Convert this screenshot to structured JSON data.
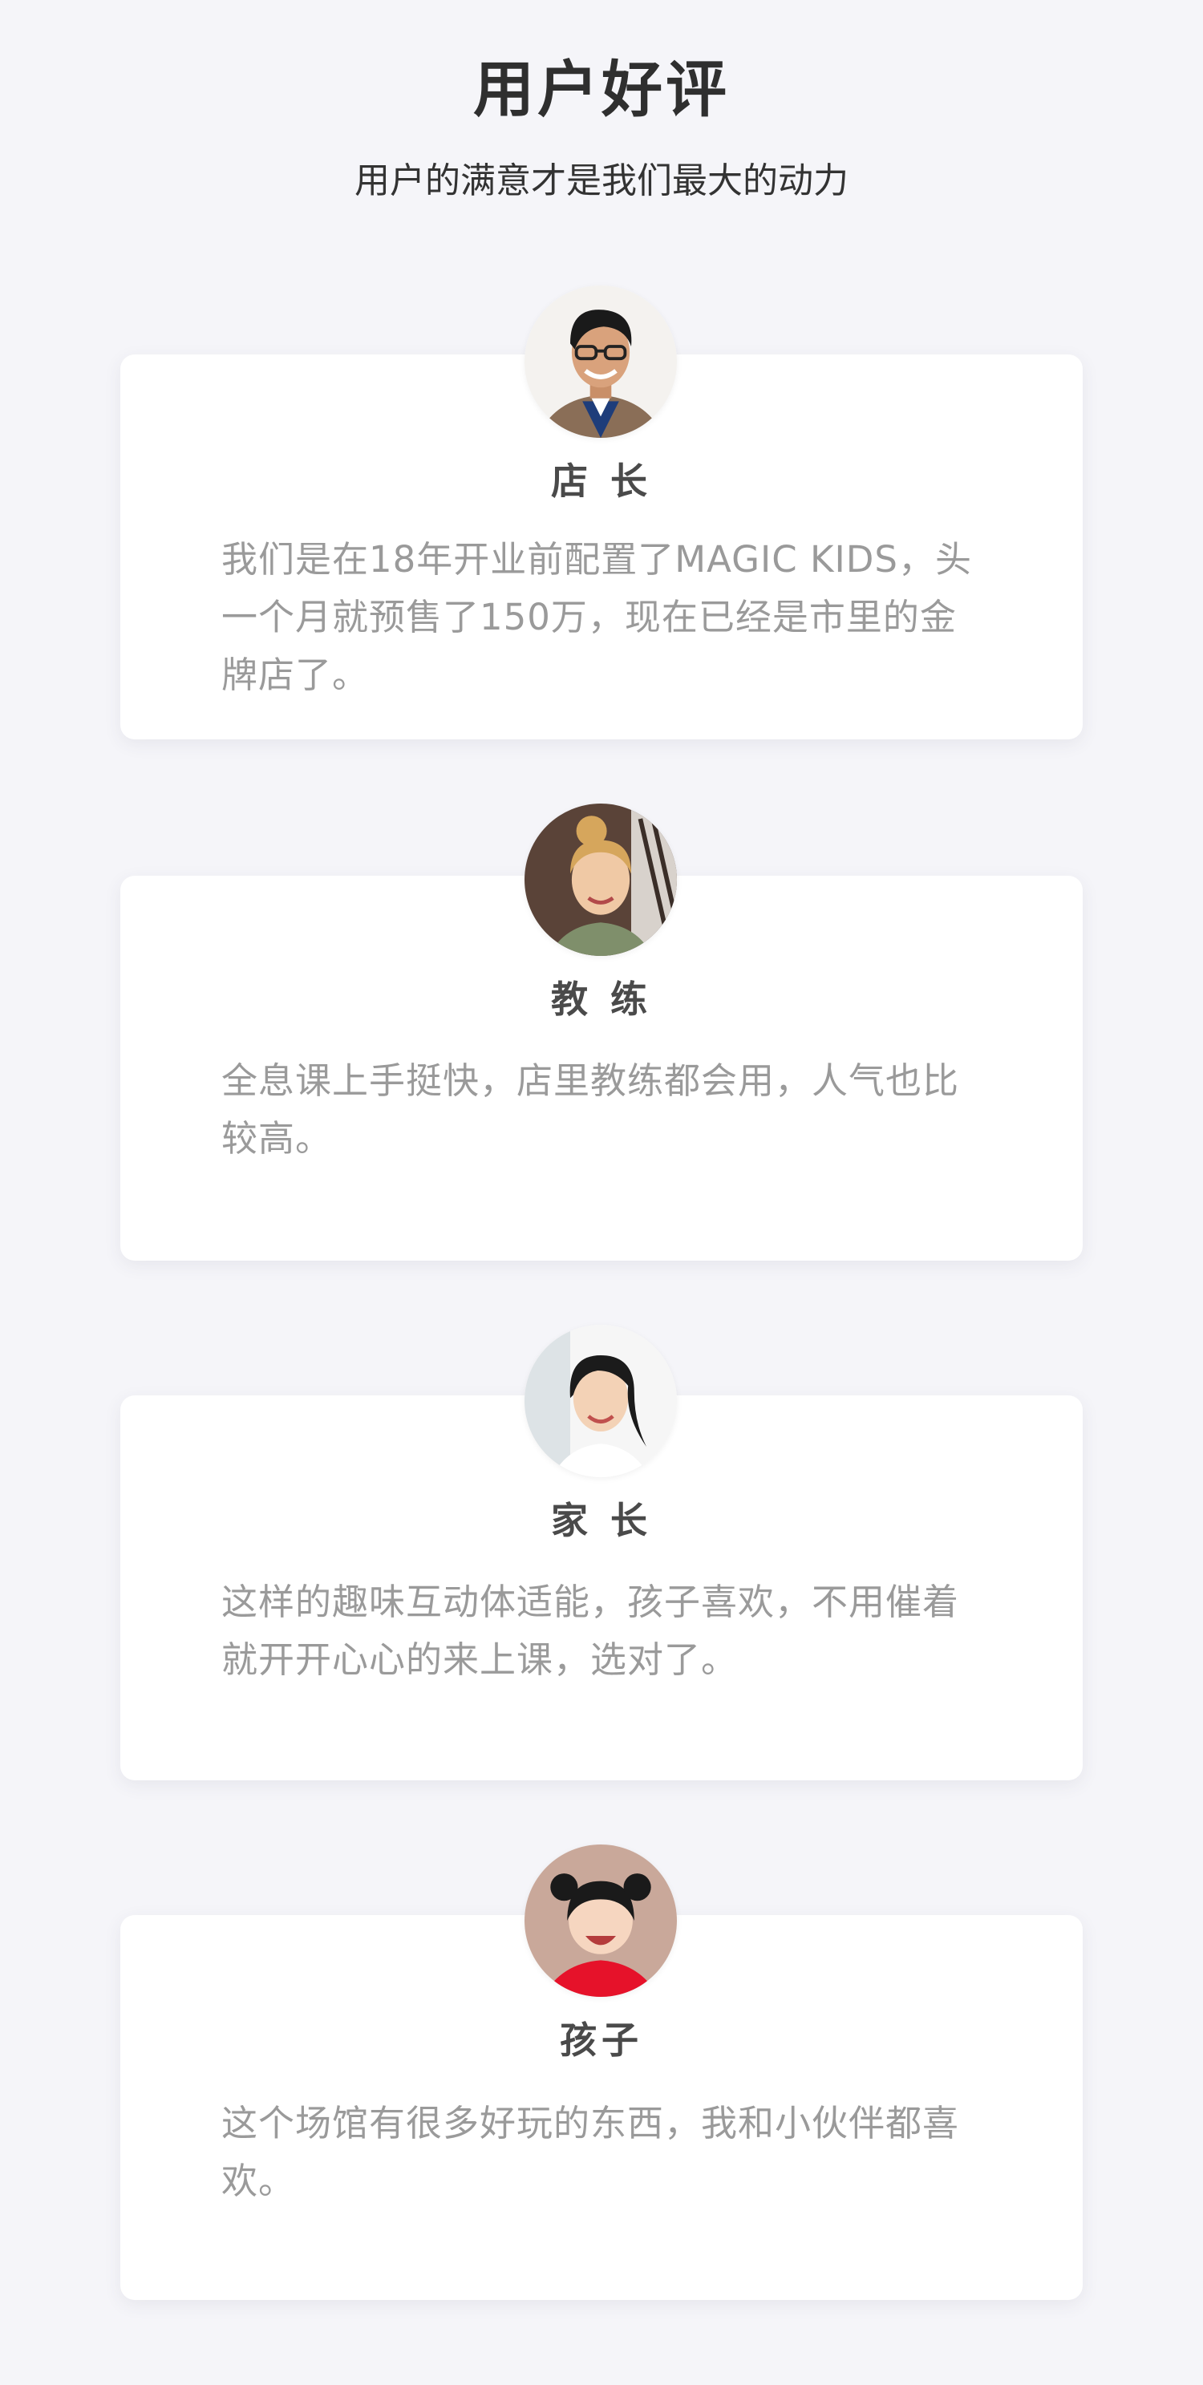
{
  "header": {
    "title": "用户好评",
    "subtitle": "用户的满意才是我们最大的动力"
  },
  "reviews": [
    {
      "role": "店 长",
      "text": "我们是在18年开业前配置了MAGIC KIDS，头一个月就预售了150万，现在已经是市里的金牌店了。",
      "avatar_icon": "store-manager-avatar"
    },
    {
      "role": "教 练",
      "text": "全息课上手挺快，店里教练都会用，人气也比较高。",
      "avatar_icon": "coach-avatar"
    },
    {
      "role": "家 长",
      "text": "这样的趣味互动体适能，孩子喜欢，不用催着就开开心心的来上课，选对了。",
      "avatar_icon": "parent-avatar"
    },
    {
      "role": "孩子",
      "text": "这个场馆有很多好玩的东西，我和小伙伴都喜欢。",
      "avatar_icon": "child-avatar"
    }
  ]
}
